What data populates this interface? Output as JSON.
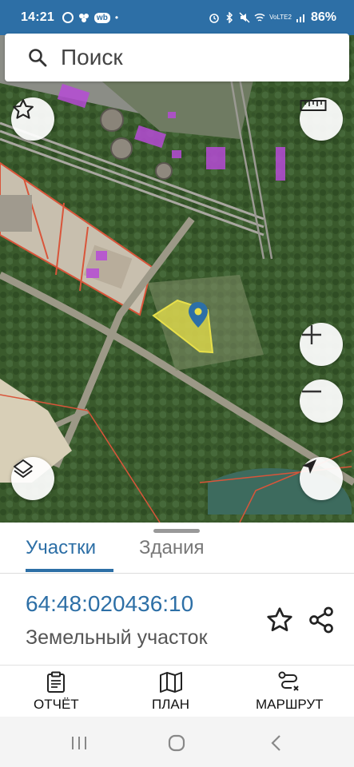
{
  "status_bar": {
    "time": "14:21",
    "wb_badge": "wb",
    "network": "VoLTE2",
    "battery": "86%"
  },
  "search": {
    "placeholder": "Поиск"
  },
  "tabs": [
    {
      "label": "Участки",
      "active": true
    },
    {
      "label": "Здания",
      "active": false
    }
  ],
  "parcel": {
    "cadastral_number": "64:48:020436:10",
    "type": "Земельный участок"
  },
  "actions": {
    "report": "ОТЧЁТ",
    "plan": "ПЛАН",
    "route": "МАРШРУТ"
  },
  "icons": {
    "search": "search-icon",
    "menu": "hamburger-menu-icon",
    "favorites": "star-icon",
    "ruler": "ruler-icon",
    "zoom_in": "plus-icon",
    "zoom_out": "minus-icon",
    "layers": "layers-icon",
    "location": "navigation-arrow-icon",
    "marker": "map-pin-icon",
    "share": "share-icon",
    "report": "clipboard-icon",
    "plan": "map-icon",
    "route": "route-icon"
  },
  "colors": {
    "brand": "#2d6fa6",
    "selected_parcel": "#e8e04a",
    "parcel_border": "#d9553a",
    "building_overlay": "#b64bd6"
  }
}
